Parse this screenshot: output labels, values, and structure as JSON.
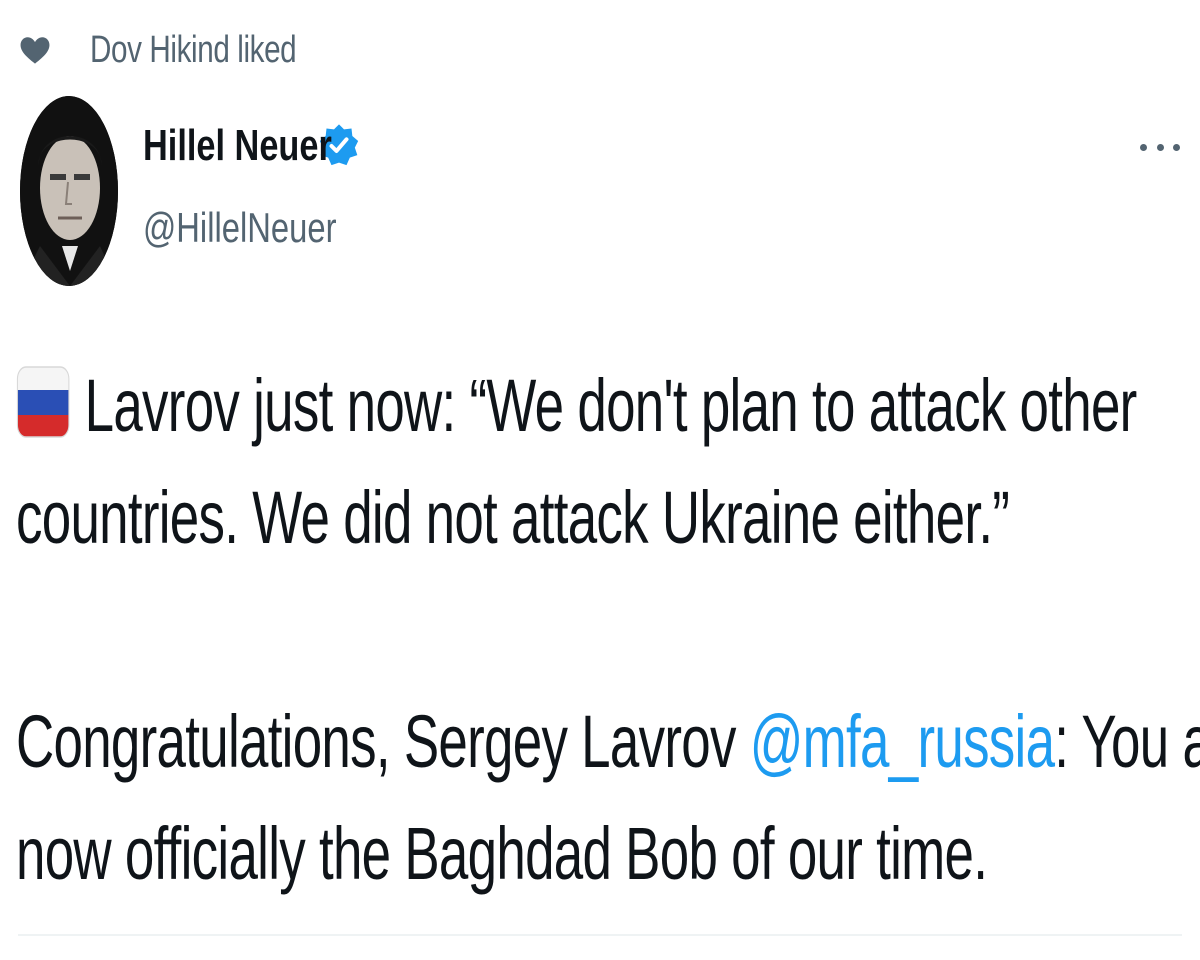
{
  "social_context": {
    "text": "Dov Hikind liked",
    "icon": "heart-icon"
  },
  "author": {
    "display_name": "Hillel Neuer",
    "handle": "@HillelNeuer",
    "verified_icon": "verified-badge-icon"
  },
  "tweet": {
    "flag_icon": "russia-flag-icon",
    "line1_text": "Lavrov just now: “We don't plan to attack other",
    "line2_text": "countries. We did not attack Ukraine either.”",
    "line3_before": "Congratulations, Sergey Lavrov ",
    "line3_mention": "@mfa_russia",
    "line3_after": ": You are",
    "line4_text": "now officially the Baghdad Bob of our time."
  },
  "colors": {
    "text": "#0f1419",
    "secondary": "#536471",
    "link": "#1d9bf0",
    "verified": "#1d9bf0",
    "divider": "#eff3f4"
  }
}
